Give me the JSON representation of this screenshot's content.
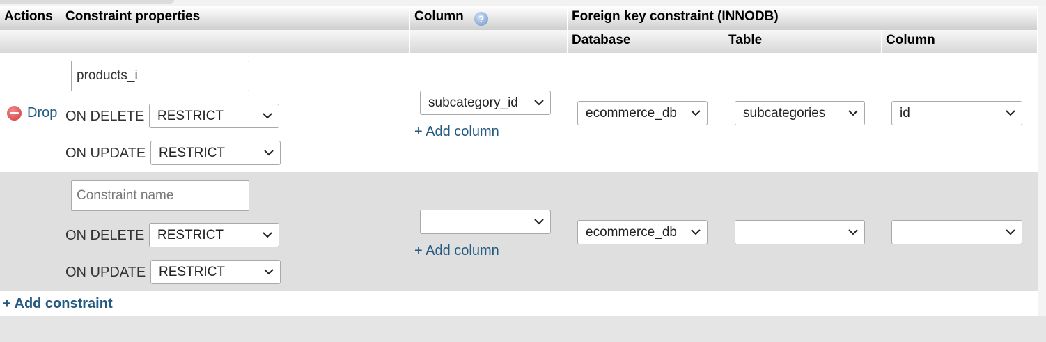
{
  "headers": {
    "actions": "Actions",
    "constraint_properties": "Constraint properties",
    "column": "Column",
    "foreign_key": "Foreign key constraint (INNODB)",
    "database": "Database",
    "table": "Table",
    "ref_column": "Column"
  },
  "icons": {
    "help": "help-icon",
    "drop": "drop-icon",
    "chevron": "chevron-down-icon"
  },
  "rows": [
    {
      "drop_label": "Drop",
      "constraint_name_value": "products_i",
      "on_delete_label": "ON DELETE",
      "on_delete_value": "RESTRICT",
      "on_update_label": "ON UPDATE",
      "on_update_value": "RESTRICT",
      "column_value": "subcategory_id",
      "add_column_label": "+ Add column",
      "database_value": "ecommerce_db",
      "table_value": "subcategories",
      "ref_column_value": "id"
    },
    {
      "constraint_name_placeholder": "Constraint name",
      "on_delete_label": "ON DELETE",
      "on_delete_value": "RESTRICT",
      "on_update_label": "ON UPDATE",
      "on_update_value": "RESTRICT",
      "column_value": "",
      "add_column_label": "+ Add column",
      "database_value": "ecommerce_db",
      "table_value": "",
      "ref_column_value": ""
    }
  ],
  "add_constraint_label": "+ Add constraint",
  "colors": {
    "link": "#235a81",
    "row_alt": "#dfdfdf",
    "drop_icon": "#d0393a"
  }
}
